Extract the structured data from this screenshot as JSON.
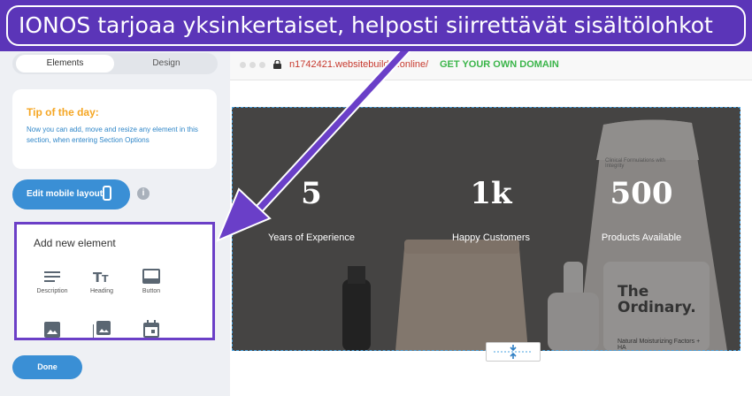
{
  "banner": {
    "text": "IONOS tarjoaa yksinkertaiset, helposti siirrettävät sisältölohkot"
  },
  "tabs": {
    "elements": "Elements",
    "design": "Design"
  },
  "tip": {
    "title": "Tip of the day:",
    "text": "Now you can add, move and resize any element in this section, when entering Section Options"
  },
  "mobile_button": {
    "label": "Edit mobile layout",
    "icon": "phone-icon"
  },
  "info": {
    "glyph": "i"
  },
  "add_panel": {
    "title": "Add new element",
    "elements": [
      {
        "label": "Description",
        "icon": "text-lines-icon"
      },
      {
        "label": "Heading",
        "icon": "heading-icon"
      },
      {
        "label": "Button",
        "icon": "button-icon"
      },
      {
        "label": "",
        "icon": "image-icon"
      },
      {
        "label": "",
        "icon": "gallery-icon"
      },
      {
        "label": "",
        "icon": "calendar-icon"
      }
    ]
  },
  "done_button": {
    "label": "Done"
  },
  "browser": {
    "url": "n1742421.websitebuilder.online/",
    "domain_cta": "GET YOUR OWN DOMAIN"
  },
  "stats": [
    {
      "value": "5",
      "label": "Years of Experience"
    },
    {
      "value": "1k",
      "label": "Happy Customers"
    },
    {
      "value": "500",
      "label": "Products Available"
    }
  ],
  "product": {
    "brand": "The Ordinary.",
    "subtitle": "Natural Moisturizing Factors + HA",
    "tube_text": "Clinical Formulations with Integrity"
  },
  "colors": {
    "banner": "#5b35b8",
    "accent": "#3a8fd5",
    "tip_title": "#f5a623",
    "highlight": "#6b3fc7"
  }
}
